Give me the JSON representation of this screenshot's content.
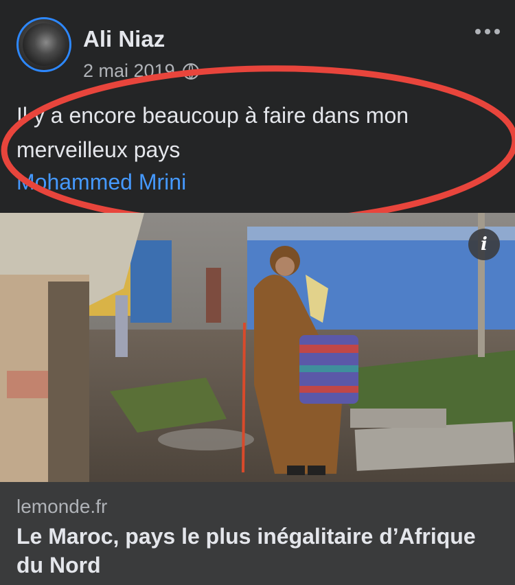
{
  "post": {
    "author": "Ali Niaz",
    "date": "2 mai 2019",
    "privacy_icon": "globe-icon",
    "text": "Il y a encore beaucoup à faire dans mon merveilleux pays",
    "mention": "Mohammed Mrini"
  },
  "link_preview": {
    "domain": "lemonde.fr",
    "title": "Le Maroc, pays le plus inégalitaire d’Afrique du Nord"
  },
  "colors": {
    "background": "#242526",
    "card": "#3a3b3c",
    "link_blue": "#4599ff",
    "annotation_red": "#e8453c",
    "avatar_ring": "#2d88ff"
  }
}
